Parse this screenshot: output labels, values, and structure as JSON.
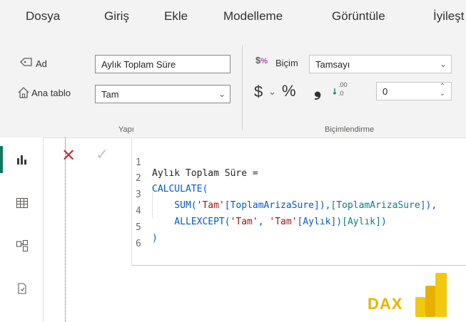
{
  "ribbon_tabs": [
    "Dosya",
    "Giriş",
    "Ekle",
    "Modelleme",
    "Görüntüle",
    "İyileşt"
  ],
  "structure": {
    "name_label": "Ad",
    "name_value": "Aylık Toplam Süre",
    "home_table_label": "Ana tablo",
    "home_table_value": "Tam",
    "group_label": "Yapı"
  },
  "formatting": {
    "format_label": "Biçim",
    "format_value": "Tamsayı",
    "currency_symbol": "$",
    "percent_symbol": "%",
    "comma_symbol": "❟",
    "decimal_places": "0",
    "group_label": "Biçimlendirme"
  },
  "formula_bar": {
    "lines": [
      {
        "num": "1",
        "text": "Aylık Toplam Süre ="
      },
      {
        "num": "2",
        "text": "CALCULATE("
      },
      {
        "num": "3",
        "text": "    SUM('Tam'[ToplamArizaSure]),"
      },
      {
        "num": "4",
        "text": "    ALLEXCEPT('Tam', 'Tam'[Aylık])"
      },
      {
        "num": "5",
        "text": ")"
      },
      {
        "num": "6",
        "text": ""
      }
    ]
  },
  "logo_text": "DAX",
  "colors": {
    "accent": "#117865",
    "cancel": "#c4314b",
    "keyword": "#035aca",
    "string": "#a31515",
    "dax": "#e6b400"
  }
}
